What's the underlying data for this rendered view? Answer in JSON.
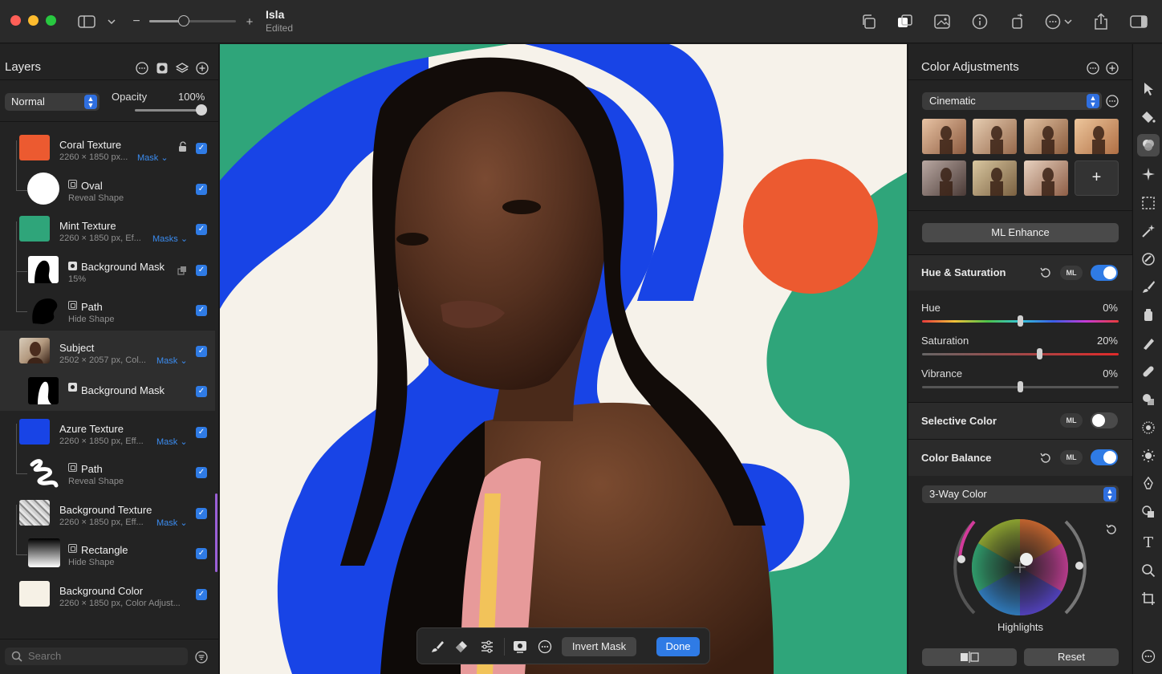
{
  "window": {
    "doc_title": "Isla",
    "doc_status": "Edited",
    "zoom_fraction": 0.4
  },
  "layers_panel": {
    "title": "Layers",
    "blend_mode": "Normal",
    "opacity_label": "Opacity",
    "opacity_value": "100%",
    "search_placeholder": "Search",
    "rows": [
      {
        "name": "Coral Texture",
        "sub": "2260 × 1850 px...",
        "mask": "Mask"
      },
      {
        "name": "Oval",
        "sub": "Reveal Shape"
      },
      {
        "name": "Mint Texture",
        "sub": "2260 × 1850 px, Ef...",
        "mask": "Masks"
      },
      {
        "name": "Background Mask",
        "sub": "15%"
      },
      {
        "name": "Path",
        "sub": "Hide Shape"
      },
      {
        "name": "Subject",
        "sub": "2502 × 2057 px, Col...",
        "mask": "Mask"
      },
      {
        "name": "Background Mask",
        "sub": ""
      },
      {
        "name": "Azure Texture",
        "sub": "2260 × 1850 px, Eff...",
        "mask": "Mask"
      },
      {
        "name": "Path",
        "sub": "Reveal Shape"
      },
      {
        "name": "Background Texture",
        "sub": "2260 × 1850 px, Eff...",
        "mask": "Mask"
      },
      {
        "name": "Rectangle",
        "sub": "Hide Shape"
      },
      {
        "name": "Background Color",
        "sub": "2260 × 1850 px, Color Adjust..."
      }
    ]
  },
  "canvas_toolbar": {
    "invert_mask": "Invert Mask",
    "done": "Done"
  },
  "adjustments": {
    "title": "Color Adjustments",
    "preset": "Cinematic",
    "add_preset": "+",
    "ml_enhance": "ML Enhance",
    "ml_badge": "ML",
    "hue_sat": {
      "title": "Hue & Saturation",
      "enabled": true,
      "hue_label": "Hue",
      "hue_value": "0%",
      "saturation_label": "Saturation",
      "saturation_value": "20%",
      "vibrance_label": "Vibrance",
      "vibrance_value": "0%"
    },
    "selective_color": {
      "title": "Selective Color",
      "enabled": false
    },
    "color_balance": {
      "title": "Color Balance",
      "enabled": true,
      "mode": "3-Way Color",
      "wheel_label": "Highlights"
    },
    "reset": "Reset"
  },
  "colors": {
    "accent": "#2f7be5",
    "coral": "#ec5a30",
    "mint": "#2fa57a",
    "azure": "#1844e6",
    "cream": "#f6f1e6"
  }
}
